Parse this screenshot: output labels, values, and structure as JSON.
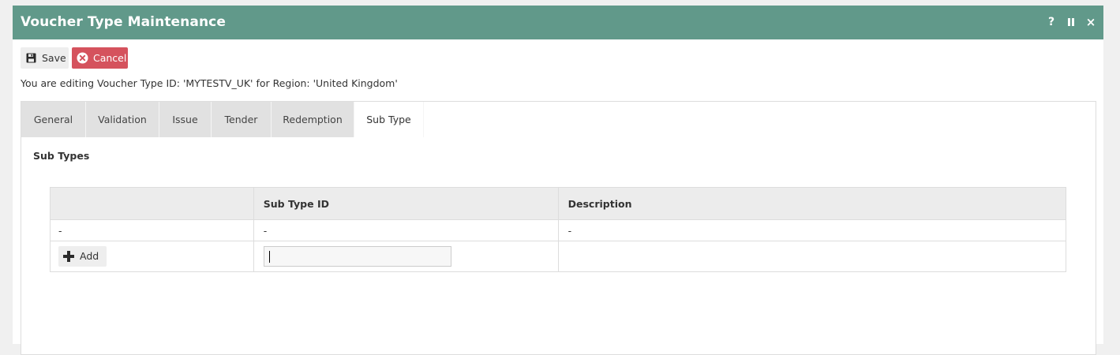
{
  "window": {
    "title": "Voucher Type Maintenance",
    "controls": {
      "help": "?",
      "close": "×"
    }
  },
  "toolbar": {
    "save_label": "Save",
    "cancel_label": "Cancel"
  },
  "edit_info": "You are editing Voucher Type ID: 'MYTESTV_UK' for Region: 'United Kingdom'",
  "tabs": [
    {
      "label": "General",
      "active": false
    },
    {
      "label": "Validation",
      "active": false
    },
    {
      "label": "Issue",
      "active": false
    },
    {
      "label": "Tender",
      "active": false
    },
    {
      "label": "Redemption",
      "active": false
    },
    {
      "label": "Sub Type",
      "active": true
    }
  ],
  "section": {
    "title": "Sub Types"
  },
  "grid": {
    "columns": [
      "",
      "Sub Type ID",
      "Description"
    ],
    "rows": [
      [
        "-",
        "-",
        "-"
      ]
    ],
    "add_label": "Add",
    "new_subtype_value": ""
  },
  "colors": {
    "titlebar": "#61998a",
    "cancel": "#d5525d",
    "tab_inactive": "#e1e1e1",
    "header_bg": "#ececec"
  }
}
